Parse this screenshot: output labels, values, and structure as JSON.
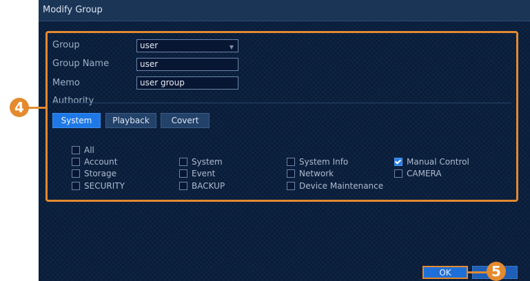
{
  "dialog": {
    "title": "Modify Group"
  },
  "form": {
    "group_label": "Group",
    "group_value": "user",
    "group_name_label": "Group Name",
    "group_name_value": "user",
    "memo_label": "Memo",
    "memo_value": "user group"
  },
  "authority": {
    "label": "Authority",
    "tabs": [
      "System",
      "Playback",
      "Covert"
    ],
    "active_tab": "System",
    "items": [
      {
        "label": "All",
        "checked": false
      },
      {
        "label": "Account",
        "checked": false
      },
      {
        "label": "System",
        "checked": false
      },
      {
        "label": "System Info",
        "checked": false
      },
      {
        "label": "Manual Control",
        "checked": true
      },
      {
        "label": "Storage",
        "checked": false
      },
      {
        "label": "Event",
        "checked": false
      },
      {
        "label": "Network",
        "checked": false
      },
      {
        "label": "CAMERA",
        "checked": false
      },
      {
        "label": "SECURITY",
        "checked": false
      },
      {
        "label": "BACKUP",
        "checked": false
      },
      {
        "label": "Device Maintenance",
        "checked": false
      }
    ]
  },
  "buttons": {
    "ok": "OK"
  },
  "callouts": {
    "step4": "4",
    "step5": "5"
  },
  "colors": {
    "accent": "#e48a2f",
    "active_tab": "#1e78e6",
    "background": "#081d3a"
  }
}
